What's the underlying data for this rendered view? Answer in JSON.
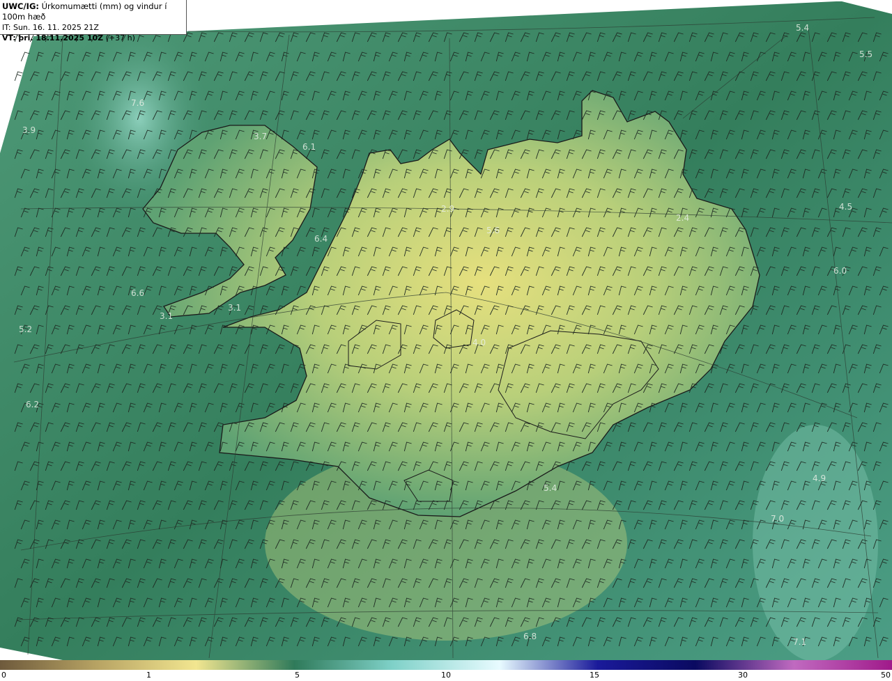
{
  "header": {
    "model_label": "UWC/IG:",
    "title": "Úrkomumætti (mm) og vindur í 100m hæð",
    "initial_time": "IT: Sun. 16. 11. 2025 21Z",
    "valid_label": "VT:",
    "valid_time": "þri. 18.11.2025 10Z",
    "lead": "(+37 h)"
  },
  "map_values": [
    "5.4",
    "5.5",
    "7.6",
    "3.9",
    "3.7",
    "6.1",
    "2.9",
    "5.6",
    "2.4",
    "4.5",
    "6.4",
    "6.0",
    "6.6",
    "3.1",
    "3.1",
    "5.2",
    "4.0",
    "6.2",
    "5.4",
    "4.9",
    "7.0",
    "6.8",
    "7.1"
  ],
  "colorbar": {
    "ticks": [
      "0",
      "1",
      "5",
      "10",
      "15",
      "30",
      "50"
    ],
    "stops": [
      "#6e5a3c",
      "#b8a464",
      "#f2e690",
      "#2f7a5a",
      "#7fd1c8",
      "#e8fbff",
      "#1a1a9a",
      "#0a0a60",
      "#c06ac0",
      "#a01a8a"
    ]
  },
  "colors": {
    "ocean_dark": "#2f7a5a",
    "ocean_light": "#6cb89f",
    "land_high": "#e6e07e",
    "coastline": "#1a1a1a",
    "wind_barb": "#1e2a22"
  }
}
